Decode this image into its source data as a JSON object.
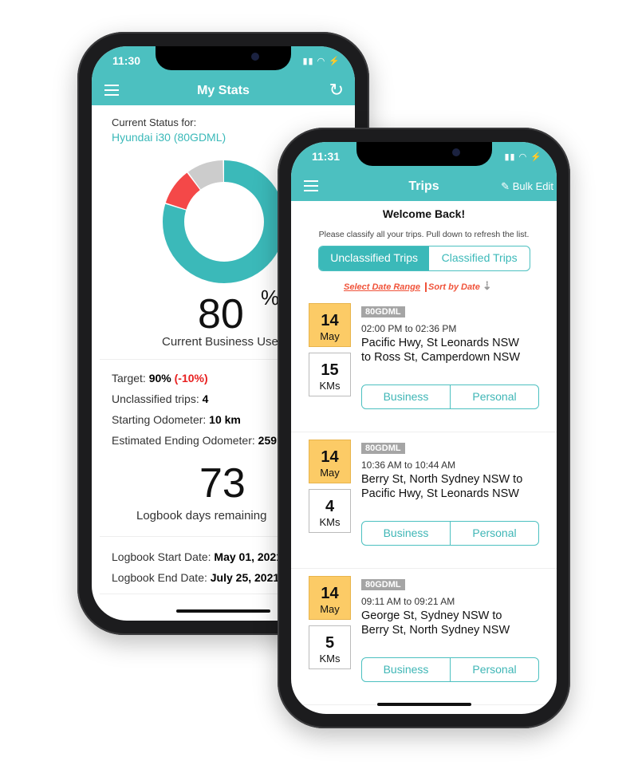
{
  "stats_phone": {
    "status_time": "11:30",
    "title": "My Stats",
    "menu_icon": "hamburger-icon",
    "refresh_icon": "refresh-icon",
    "current_status_label": "Current Status for:",
    "vehicle": "Hyundai i30 (80GDML)",
    "chart_data": {
      "type": "pie",
      "style": "donut",
      "slices": [
        {
          "label": "Business",
          "value": 80,
          "color": "#3bb9b9"
        },
        {
          "label": "Shortfall",
          "value": 10,
          "color": "#f44848"
        },
        {
          "label": "Remaining",
          "value": 10,
          "color": "#cccccc"
        }
      ]
    },
    "business_percent": "80",
    "percent_sign": "%",
    "business_label": "Current Business Use",
    "target_label": "Target:",
    "target_value": "90%",
    "target_diff": "(-10%)",
    "unclassified_label": "Unclassified trips:",
    "unclassified_value": "4",
    "start_odo_label": "Starting Odometer:",
    "start_odo_value": "10 km",
    "end_odo_label": "Estimated Ending Odometer:",
    "end_odo_value": "259",
    "days_remaining": "73",
    "days_label": "Logbook days remaining",
    "start_date_label": "Logbook Start Date:",
    "start_date_value": "May 01, 2021",
    "end_date_label": "Logbook End Date:",
    "end_date_value": "July 25, 2021"
  },
  "trips_phone": {
    "status_time": "11:31",
    "title": "Trips",
    "bulk_edit": "Bulk Edit",
    "bulk_edit_icon": "edit-icon",
    "welcome": "Welcome Back!",
    "hint": "Please classify all your trips. Pull down to refresh the list.",
    "tabs": [
      {
        "label": "Unclassified Trips",
        "active": true
      },
      {
        "label": "Classified Trips",
        "active": false
      }
    ],
    "select_date_range": "Select Date Range",
    "sort_by_date": "Sort by Date",
    "sort_icon": "sort-descending-icon",
    "trips": [
      {
        "day": "14",
        "month": "May",
        "km": "15",
        "km_unit": "KMs",
        "plate": "80GDML",
        "time": "02:00 PM to 02:36 PM",
        "route_1": "Pacific Hwy, St Leonards NSW",
        "route_2": "to Ross St, Camperdown NSW",
        "business": "Business",
        "personal": "Personal"
      },
      {
        "day": "14",
        "month": "May",
        "km": "4",
        "km_unit": "KMs",
        "plate": "80GDML",
        "time": "10:36 AM to 10:44 AM",
        "route_1": "Berry St, North Sydney NSW to",
        "route_2": "Pacific Hwy, St Leonards NSW",
        "business": "Business",
        "personal": "Personal"
      },
      {
        "day": "14",
        "month": "May",
        "km": "5",
        "km_unit": "KMs",
        "plate": "80GDML",
        "time": "09:11 AM to 09:21 AM",
        "route_1": "George St, Sydney NSW to",
        "route_2": "Berry St, North Sydney NSW",
        "business": "Business",
        "personal": "Personal"
      }
    ]
  },
  "colors": {
    "accent": "#4cc0c0",
    "date_badge": "#fccb66",
    "link_red": "#f0533a",
    "negative": "#e82020"
  }
}
